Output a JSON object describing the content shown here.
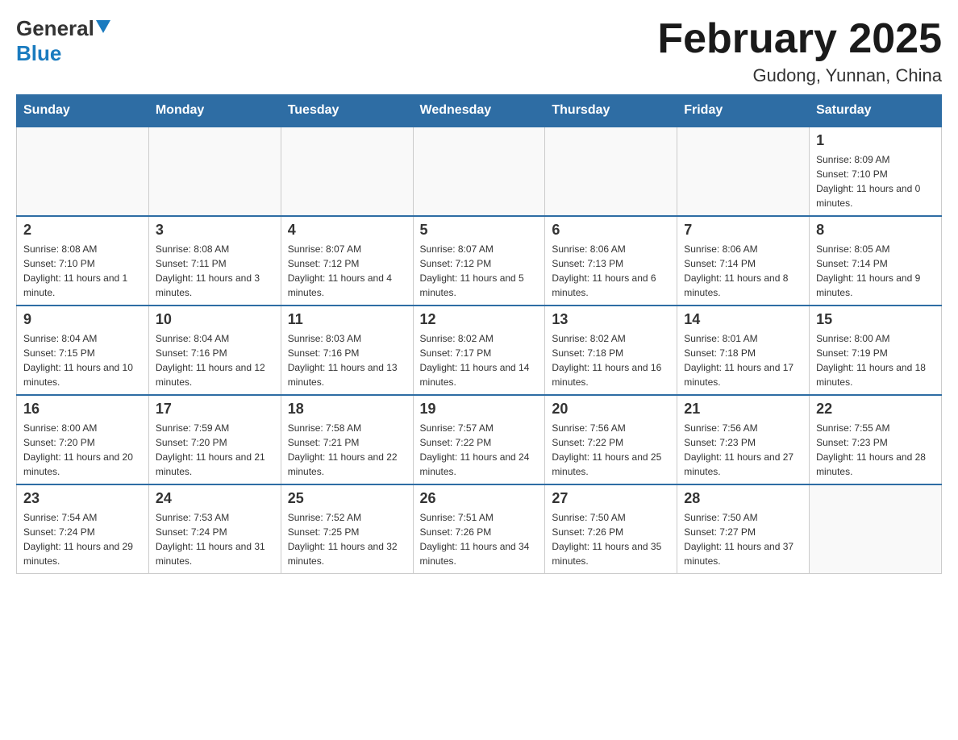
{
  "header": {
    "logo_general": "General",
    "logo_blue": "Blue",
    "title": "February 2025",
    "subtitle": "Gudong, Yunnan, China"
  },
  "days_of_week": [
    "Sunday",
    "Monday",
    "Tuesday",
    "Wednesday",
    "Thursday",
    "Friday",
    "Saturday"
  ],
  "weeks": [
    [
      {
        "day": "",
        "info": ""
      },
      {
        "day": "",
        "info": ""
      },
      {
        "day": "",
        "info": ""
      },
      {
        "day": "",
        "info": ""
      },
      {
        "day": "",
        "info": ""
      },
      {
        "day": "",
        "info": ""
      },
      {
        "day": "1",
        "info": "Sunrise: 8:09 AM\nSunset: 7:10 PM\nDaylight: 11 hours and 0 minutes."
      }
    ],
    [
      {
        "day": "2",
        "info": "Sunrise: 8:08 AM\nSunset: 7:10 PM\nDaylight: 11 hours and 1 minute."
      },
      {
        "day": "3",
        "info": "Sunrise: 8:08 AM\nSunset: 7:11 PM\nDaylight: 11 hours and 3 minutes."
      },
      {
        "day": "4",
        "info": "Sunrise: 8:07 AM\nSunset: 7:12 PM\nDaylight: 11 hours and 4 minutes."
      },
      {
        "day": "5",
        "info": "Sunrise: 8:07 AM\nSunset: 7:12 PM\nDaylight: 11 hours and 5 minutes."
      },
      {
        "day": "6",
        "info": "Sunrise: 8:06 AM\nSunset: 7:13 PM\nDaylight: 11 hours and 6 minutes."
      },
      {
        "day": "7",
        "info": "Sunrise: 8:06 AM\nSunset: 7:14 PM\nDaylight: 11 hours and 8 minutes."
      },
      {
        "day": "8",
        "info": "Sunrise: 8:05 AM\nSunset: 7:14 PM\nDaylight: 11 hours and 9 minutes."
      }
    ],
    [
      {
        "day": "9",
        "info": "Sunrise: 8:04 AM\nSunset: 7:15 PM\nDaylight: 11 hours and 10 minutes."
      },
      {
        "day": "10",
        "info": "Sunrise: 8:04 AM\nSunset: 7:16 PM\nDaylight: 11 hours and 12 minutes."
      },
      {
        "day": "11",
        "info": "Sunrise: 8:03 AM\nSunset: 7:16 PM\nDaylight: 11 hours and 13 minutes."
      },
      {
        "day": "12",
        "info": "Sunrise: 8:02 AM\nSunset: 7:17 PM\nDaylight: 11 hours and 14 minutes."
      },
      {
        "day": "13",
        "info": "Sunrise: 8:02 AM\nSunset: 7:18 PM\nDaylight: 11 hours and 16 minutes."
      },
      {
        "day": "14",
        "info": "Sunrise: 8:01 AM\nSunset: 7:18 PM\nDaylight: 11 hours and 17 minutes."
      },
      {
        "day": "15",
        "info": "Sunrise: 8:00 AM\nSunset: 7:19 PM\nDaylight: 11 hours and 18 minutes."
      }
    ],
    [
      {
        "day": "16",
        "info": "Sunrise: 8:00 AM\nSunset: 7:20 PM\nDaylight: 11 hours and 20 minutes."
      },
      {
        "day": "17",
        "info": "Sunrise: 7:59 AM\nSunset: 7:20 PM\nDaylight: 11 hours and 21 minutes."
      },
      {
        "day": "18",
        "info": "Sunrise: 7:58 AM\nSunset: 7:21 PM\nDaylight: 11 hours and 22 minutes."
      },
      {
        "day": "19",
        "info": "Sunrise: 7:57 AM\nSunset: 7:22 PM\nDaylight: 11 hours and 24 minutes."
      },
      {
        "day": "20",
        "info": "Sunrise: 7:56 AM\nSunset: 7:22 PM\nDaylight: 11 hours and 25 minutes."
      },
      {
        "day": "21",
        "info": "Sunrise: 7:56 AM\nSunset: 7:23 PM\nDaylight: 11 hours and 27 minutes."
      },
      {
        "day": "22",
        "info": "Sunrise: 7:55 AM\nSunset: 7:23 PM\nDaylight: 11 hours and 28 minutes."
      }
    ],
    [
      {
        "day": "23",
        "info": "Sunrise: 7:54 AM\nSunset: 7:24 PM\nDaylight: 11 hours and 29 minutes."
      },
      {
        "day": "24",
        "info": "Sunrise: 7:53 AM\nSunset: 7:24 PM\nDaylight: 11 hours and 31 minutes."
      },
      {
        "day": "25",
        "info": "Sunrise: 7:52 AM\nSunset: 7:25 PM\nDaylight: 11 hours and 32 minutes."
      },
      {
        "day": "26",
        "info": "Sunrise: 7:51 AM\nSunset: 7:26 PM\nDaylight: 11 hours and 34 minutes."
      },
      {
        "day": "27",
        "info": "Sunrise: 7:50 AM\nSunset: 7:26 PM\nDaylight: 11 hours and 35 minutes."
      },
      {
        "day": "28",
        "info": "Sunrise: 7:50 AM\nSunset: 7:27 PM\nDaylight: 11 hours and 37 minutes."
      },
      {
        "day": "",
        "info": ""
      }
    ]
  ]
}
